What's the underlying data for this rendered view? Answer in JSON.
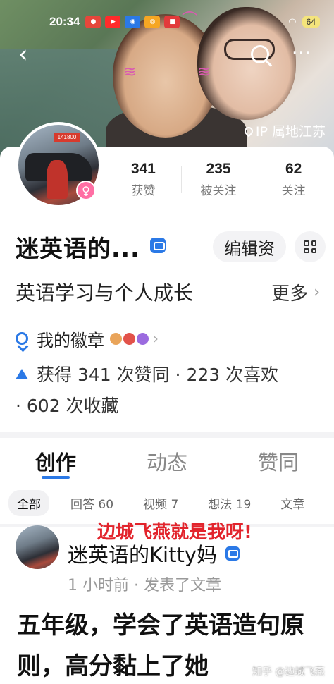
{
  "status_bar": {
    "time": "20:34",
    "battery": "64",
    "app_icons": [
      "app-red",
      "app-youtube",
      "app-blue",
      "app-weibo",
      "app-toutiao"
    ]
  },
  "header": {
    "ip_location": "IP 属地江苏",
    "avatar_plate": "141800"
  },
  "profile": {
    "name": "迷英语的...",
    "edit_label": "编辑资",
    "bio": "英语学习与个人成长",
    "more_label": "更多",
    "stats": [
      {
        "value": "341",
        "label": "获赞"
      },
      {
        "value": "235",
        "label": "被关注"
      },
      {
        "value": "62",
        "label": "关注"
      }
    ],
    "badges_label": "我的徽章",
    "agree_line1": "获得 341 次赞同 · 223 次喜欢",
    "agree_line2": "· 602 次收藏"
  },
  "tabs": [
    {
      "label": "创作",
      "active": true
    },
    {
      "label": "动态",
      "active": false
    },
    {
      "label": "赞同",
      "active": false
    }
  ],
  "subtabs": [
    {
      "label": "全部",
      "active": true
    },
    {
      "label": "回答 60"
    },
    {
      "label": "视频 7"
    },
    {
      "label": "想法 19"
    },
    {
      "label": "文章"
    }
  ],
  "feed": {
    "overlay_text": "边城飞燕就是我呀!",
    "author": "迷英语的Kitty妈",
    "meta": "1 小时前 · 发表了文章",
    "title": "五年级，学会了英语造句原则，高分黏上了她",
    "watermark": "知乎 @边城飞燕"
  },
  "colors": {
    "accent": "#2b79e6",
    "overlay_red": "#e2242c",
    "gender_pink": "#ff6fa4"
  }
}
